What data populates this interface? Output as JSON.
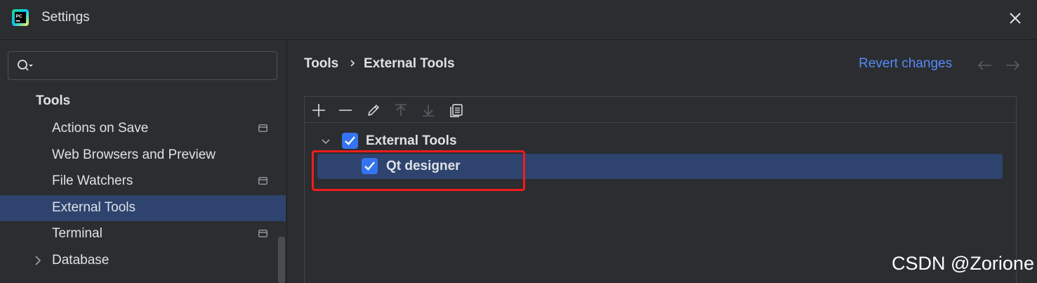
{
  "window": {
    "title": "Settings"
  },
  "sidebar": {
    "search": {
      "value": "",
      "placeholder": ""
    },
    "header": "Tools",
    "items": [
      {
        "label": "Actions on Save",
        "has_project_icon": true
      },
      {
        "label": "Web Browsers and Preview",
        "has_project_icon": false
      },
      {
        "label": "File Watchers",
        "has_project_icon": true
      },
      {
        "label": "External Tools",
        "selected": true
      },
      {
        "label": "Terminal",
        "has_project_icon": true
      },
      {
        "label": "Database",
        "expandable": true
      }
    ]
  },
  "content": {
    "breadcrumb": [
      "Tools",
      "External Tools"
    ],
    "revert_label": "Revert changes",
    "toolbar": [
      "add-icon",
      "remove-icon",
      "edit-icon",
      "move-up-icon",
      "move-down-icon",
      "copy-icon"
    ],
    "tree": {
      "group": {
        "label": "External Tools",
        "checked": true,
        "expanded": true
      },
      "items": [
        {
          "label": "Qt designer",
          "checked": true,
          "selected": true
        }
      ]
    }
  },
  "watermark": "CSDN @Zorione",
  "colors": {
    "background": "#2b2d30",
    "selection": "#2e436e",
    "accent": "#3574f0",
    "link": "#548af7",
    "highlight": "#f01c1c"
  }
}
